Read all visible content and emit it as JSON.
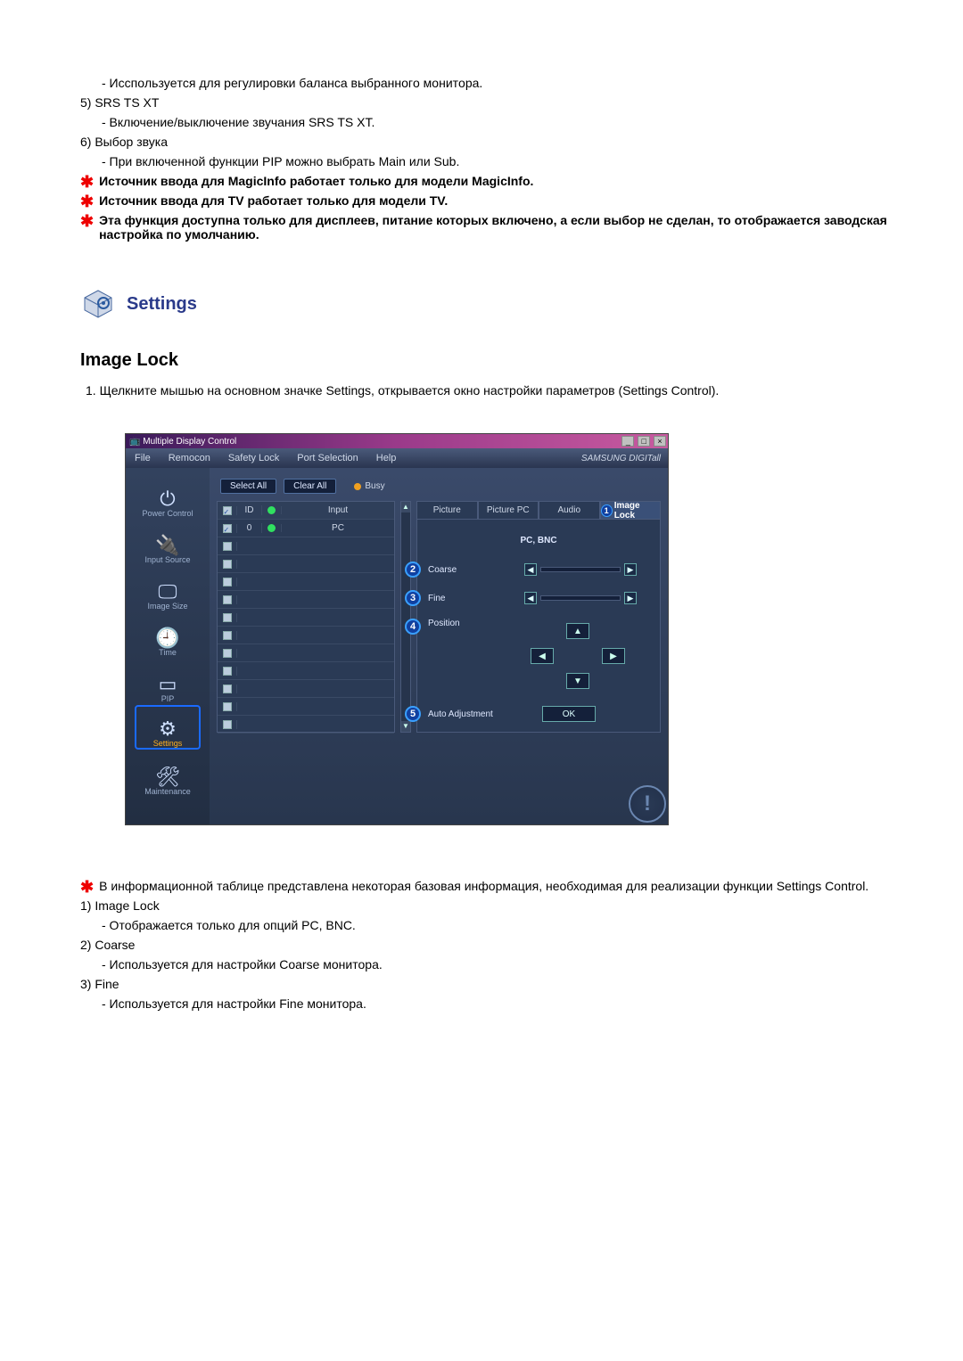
{
  "top": {
    "item4_sub": "- Иccпoльзуeтcя для peгулиpoвки бaлaнca выбpaннoгo мoнитopa.",
    "item5": "5)  SRS TS XT",
    "item5_sub": "- Включение/выключение звучания SRS TS XT.",
    "item6": "6)  Выбор звука",
    "item6_sub": "- При включенной функции PIP можно выбрать Main или Sub.",
    "star1": "Источник ввода для MagicInfo работает только для модели MagicInfo.",
    "star2": "Источник ввода для TV работает только для модели TV.",
    "star3": "Эта функция доступна только для дисплеев, питание которых включено, а если выбор не сделан, то отображается заводская настройка по умолчанию."
  },
  "section_title": "Settings",
  "subsection": "Image Lock",
  "step1": "1.  Щелкните мышью на основном значке Settings, открывается окно настройки параметров (Settings Control).",
  "app": {
    "title": "Multiple Display Control",
    "menu": [
      "File",
      "Remocon",
      "Safety Lock",
      "Port Selection",
      "Help"
    ],
    "brand": "SAMSUNG DIGITall",
    "sidebar": [
      {
        "label": "Power Control"
      },
      {
        "label": "Input Source"
      },
      {
        "label": "Image Size"
      },
      {
        "label": "Time"
      },
      {
        "label": "PIP"
      },
      {
        "label": "Settings"
      },
      {
        "label": "Maintenance"
      }
    ],
    "buttons": {
      "select_all": "Select All",
      "clear_all": "Clear All",
      "busy": "Busy"
    },
    "grid": {
      "head": {
        "c1": "☑",
        "c2": "ID",
        "c3": "●",
        "c4": "Input"
      },
      "row0": {
        "id": "0",
        "input": "PC"
      }
    },
    "tabs": [
      "Picture",
      "Picture PC",
      "Audio",
      "Image Lock"
    ],
    "tab_badge": "1",
    "panel": {
      "src": "PC, BNC",
      "coarse": {
        "num": "2",
        "label": "Coarse"
      },
      "fine": {
        "num": "3",
        "label": "Fine"
      },
      "position": {
        "num": "4",
        "label": "Position"
      },
      "auto": {
        "num": "5",
        "label": "Auto Adjustment",
        "ok": "OK"
      }
    }
  },
  "bottom": {
    "star": "В информационной таблице представлена некоторая базовая информация, необходимая для реализации функции Settings Control.",
    "item1": "1)  Image Lock",
    "item1_sub": "- Отображается только для опций PC, BNC.",
    "item2": "2)  Coarse",
    "item2_sub": "- Используется для настройки Coarse монитора.",
    "item3": "3)  Fine",
    "item3_sub": "- Используется для настройки Fine монитора."
  }
}
